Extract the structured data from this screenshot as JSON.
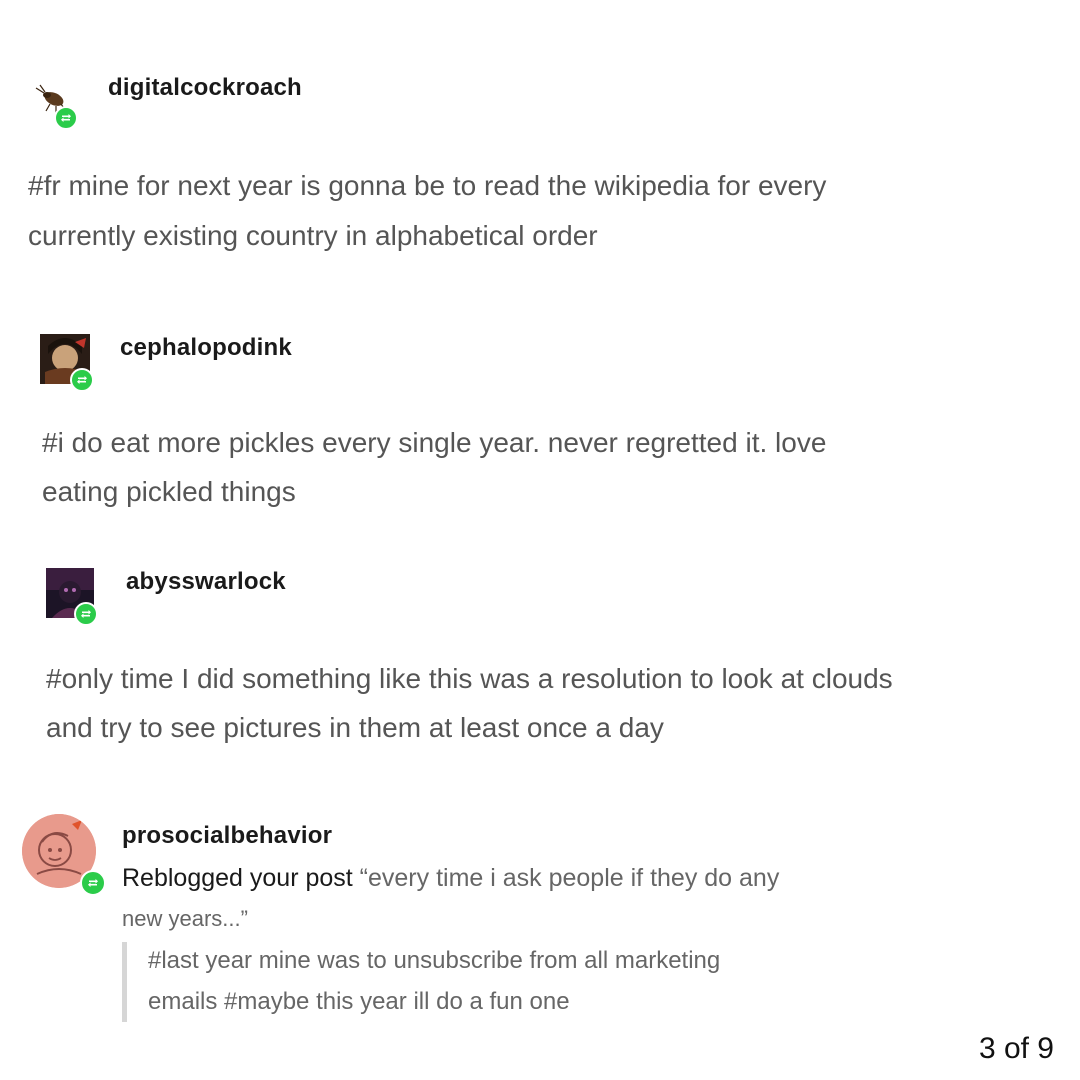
{
  "notes": [
    {
      "username": "digitalcockroach",
      "tag_lines": [
        "#fr mine for next year is gonna be to read the wikipedia for every",
        "currently existing country in alphabetical order"
      ],
      "avatar_icon": "cockroach-avatar-icon",
      "badge_icon": "reblog-icon"
    },
    {
      "username": "cephalopodink",
      "tag_lines": [
        "#i do eat more pickles every single year. never regretted it. love",
        "eating pickled things"
      ],
      "avatar_icon": "character-avatar-icon",
      "badge_icon": "reblog-icon"
    },
    {
      "username": "abysswarlock",
      "tag_lines": [
        "#only time I did something like this was a resolution to look at clouds",
        "and try to see pictures in them at least once a day"
      ],
      "avatar_icon": "dark-character-avatar-icon",
      "badge_icon": "reblog-icon"
    },
    {
      "username": "prosocialbehavior",
      "reblog_prefix": "Reblogged your post",
      "post_title_line1": "“every time i ask people if they do any",
      "post_title_line2": "new years...”",
      "quote_lines": [
        "#last year mine was to unsubscribe from all marketing",
        "emails #maybe this year ill do a fun one"
      ],
      "avatar_icon": "sketch-avatar-icon",
      "badge_icon": "reblog-icon"
    }
  ],
  "page_counter": "3 of 9",
  "colors": {
    "reblog_green": "#2bcc4a",
    "tag_text": "#555555",
    "quote_bar": "#d6d6d6"
  }
}
